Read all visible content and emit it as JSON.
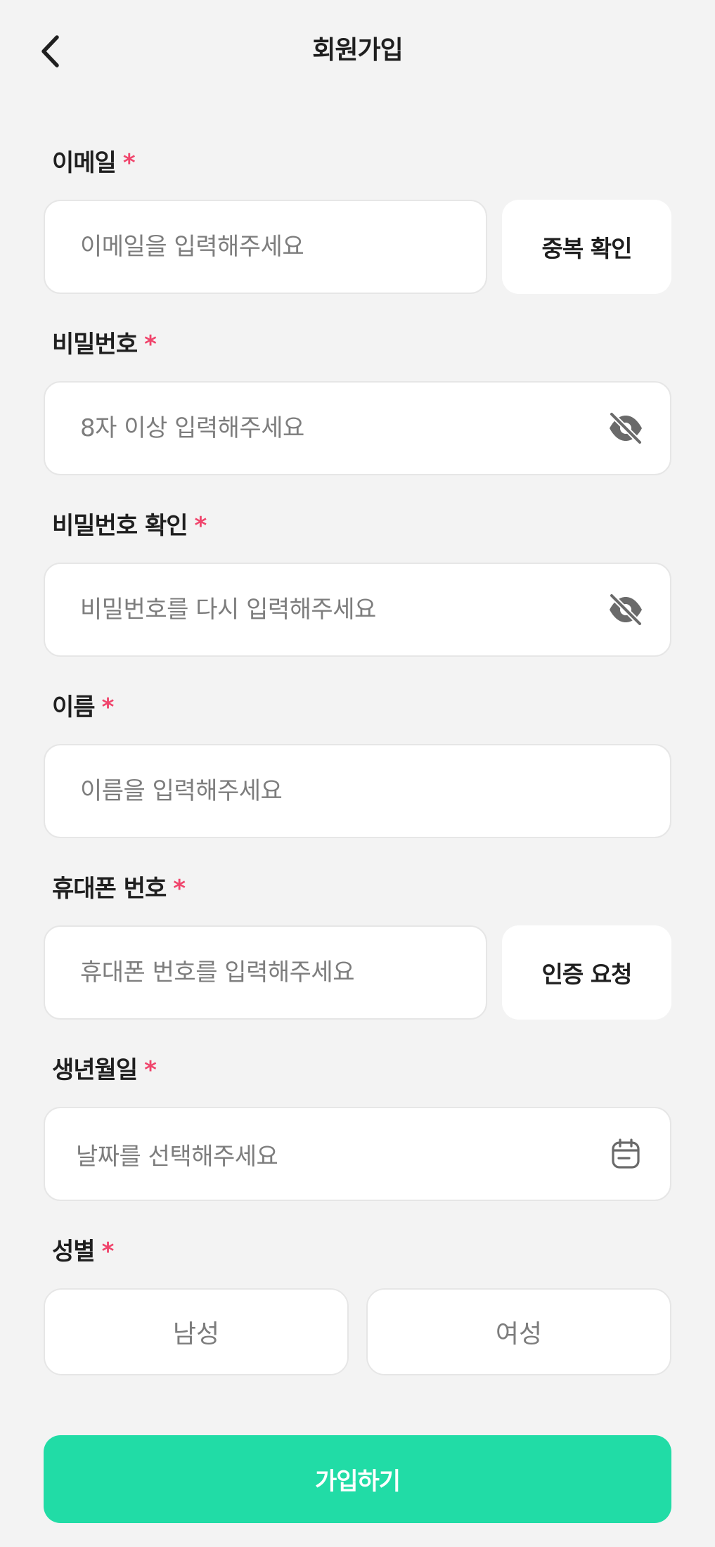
{
  "header": {
    "title": "회원가입",
    "back_icon": "chevron-left-icon"
  },
  "required_mark": "*",
  "colors": {
    "background": "#f3f3f3",
    "accent": "#21dca6",
    "required": "#f0456c",
    "placeholder": "#7d7d7d"
  },
  "email": {
    "label": "이메일",
    "placeholder": "이메일을 입력해주세요",
    "value": "",
    "action_label": "중복 확인"
  },
  "password": {
    "label": "비밀번호",
    "placeholder": "8자 이상 입력해주세요",
    "value": "",
    "toggle_icon": "eye-off-icon"
  },
  "password_confirm": {
    "label": "비밀번호 확인",
    "placeholder": "비밀번호를 다시 입력해주세요",
    "value": "",
    "toggle_icon": "eye-off-icon"
  },
  "name": {
    "label": "이름",
    "placeholder": "이름을 입력해주세요",
    "value": ""
  },
  "phone": {
    "label": "휴대폰 번호",
    "placeholder": "휴대폰 번호를 입력해주세요",
    "value": "",
    "action_label": "인증 요청"
  },
  "birthdate": {
    "label": "생년월일",
    "placeholder": "날짜를 선택해주세요",
    "icon": "calendar-icon"
  },
  "gender": {
    "label": "성별",
    "options": [
      "남성",
      "여성"
    ],
    "selected": null
  },
  "submit": {
    "label": "가입하기"
  }
}
